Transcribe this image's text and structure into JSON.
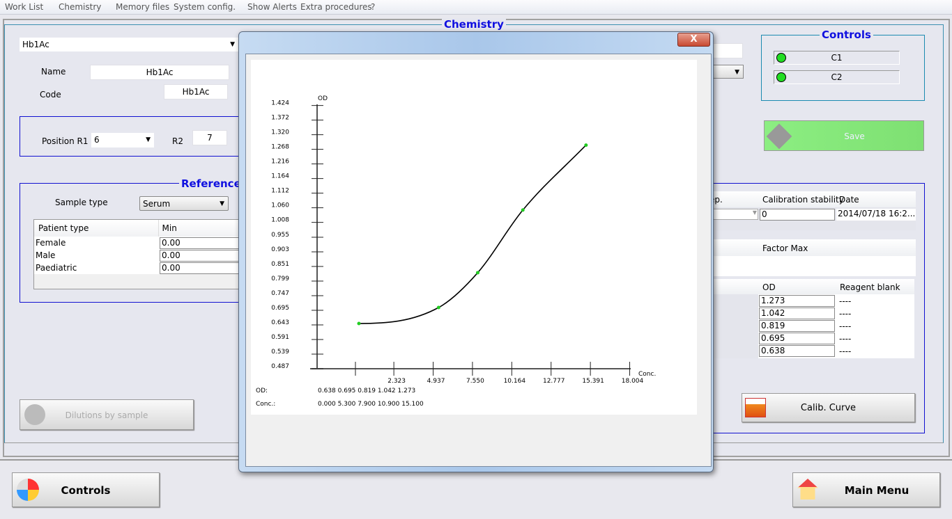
{
  "menu": [
    "Work List",
    "Chemistry",
    "Memory files",
    "System config.",
    "Show Alerts",
    "Extra procedures",
    "?"
  ],
  "panel_title": "Chemistry",
  "test_select": "Hb1Ac",
  "name_label": "Name",
  "name_value": "Hb1Ac",
  "code_label": "Code",
  "code_value": "Hb1Ac",
  "position_r1_label": "Position R1",
  "position_r1_value": "6",
  "r2_label": "R2",
  "r2_value": "7",
  "reference": {
    "title": "Reference",
    "sample_type_label": "Sample type",
    "sample_type_value": "Serum",
    "headers": [
      "Patient type",
      "Min"
    ],
    "rows": [
      {
        "type": "Female",
        "min": "0.00"
      },
      {
        "type": "Male",
        "min": "0.00"
      },
      {
        "type": "Paediatric",
        "min": "0.00"
      }
    ]
  },
  "dilutions_button": "Dilutions by sample",
  "controls": {
    "title": "Controls",
    "items": [
      {
        "label": "C1",
        "status_color": "#22dd22"
      },
      {
        "label": "C2",
        "status_color": "#22dd22"
      }
    ]
  },
  "save_button": "Save",
  "calib_table": {
    "headers": [
      "ep.",
      "Calibration stability",
      "Date"
    ],
    "stability": "0",
    "date": "2014/07/18 16:2..."
  },
  "factor_header": "Factor Max",
  "od_table": {
    "headers": [
      "OD",
      "Reagent blank"
    ],
    "rows": [
      {
        "od": "1.273",
        "blank": "----"
      },
      {
        "od": "1.042",
        "blank": "----"
      },
      {
        "od": "0.819",
        "blank": "----"
      },
      {
        "od": "0.695",
        "blank": "----"
      },
      {
        "od": "0.638",
        "blank": "----"
      }
    ]
  },
  "calib_curve_button": "Calib. Curve",
  "controls_button": "Controls",
  "main_menu_button": "Main Menu",
  "dialog": {
    "close_label": "X"
  },
  "chart_data": {
    "type": "line",
    "xlabel": "Conc.",
    "ylabel": "OD",
    "x_ticks": [
      "2.323",
      "4.937",
      "7.550",
      "10.164",
      "12.777",
      "15.391",
      "18.004"
    ],
    "y_ticks": [
      "1.424",
      "1.372",
      "1.320",
      "1.268",
      "1.216",
      "1.164",
      "1.112",
      "1.060",
      "1.008",
      "0.955",
      "0.903",
      "0.851",
      "0.799",
      "0.747",
      "0.695",
      "0.643",
      "0.591",
      "0.539",
      "0.487"
    ],
    "x": [
      0.0,
      5.3,
      7.9,
      10.9,
      15.1
    ],
    "y": [
      0.638,
      0.695,
      0.819,
      1.042,
      1.273
    ],
    "point_color": "#22cc22",
    "od_row_label": "OD:",
    "od_row_values": "0.638 0.695 0.819 1.042 1.273",
    "conc_row_label": "Conc.:",
    "conc_row_values": "0.000 5.300 7.900 10.900 15.100"
  }
}
